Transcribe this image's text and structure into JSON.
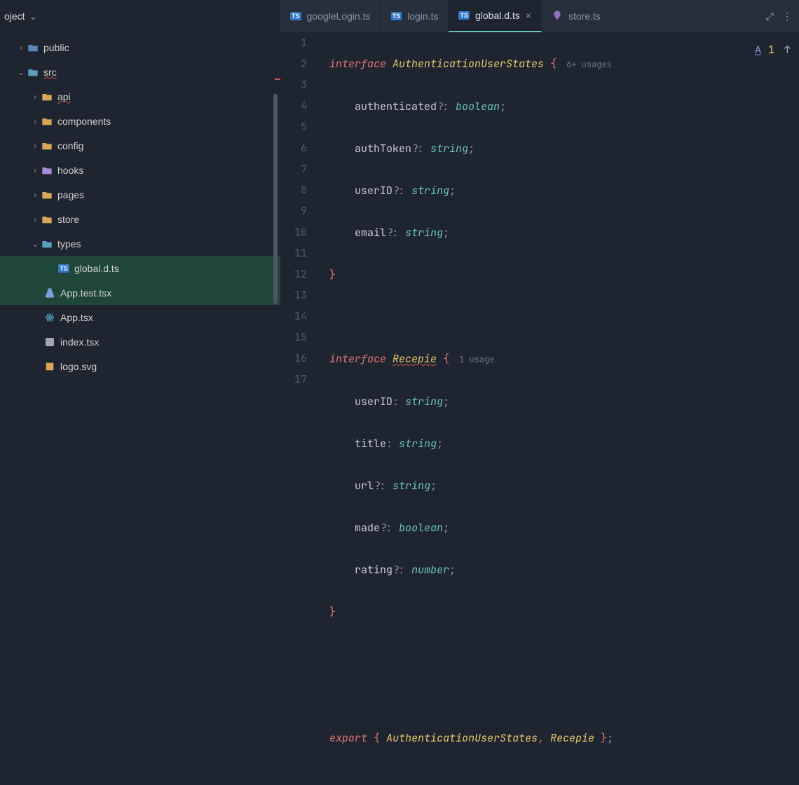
{
  "project": {
    "title": "oject"
  },
  "tree": {
    "public": "public",
    "src": "src",
    "api": "api",
    "components": "components",
    "config": "config",
    "hooks": "hooks",
    "pages": "pages",
    "store": "store",
    "types": "types",
    "globaldts": "global.d.ts",
    "apptest": "App.test.tsx",
    "apptsx": "App.tsx",
    "indextsx": "index.tsx",
    "logosvg": "logo.svg"
  },
  "tabs": {
    "0": "googleLogin.ts",
    "1": "login.ts",
    "2": "global.d.ts",
    "3": "store.ts"
  },
  "inspect": {
    "count": "1"
  },
  "code": {
    "l1_kw": "interface",
    "l1_name": "AuthenticationUserStates",
    "l1_brace": "{",
    "l1_usage": "6+ usages",
    "l2_p": "authenticated",
    "l2_t": "boolean",
    "l3_p": "authToken",
    "l3_t": "string",
    "l4_p": "userID",
    "l4_t": "string",
    "l5_p": "email",
    "l5_t": "string",
    "l6_brace": "}",
    "l8_kw": "interface",
    "l8_name": "Recepie",
    "l8_brace": "{",
    "l8_usage": "1 usage",
    "l9_p": "userID",
    "l9_t": "string",
    "l10_p": "title",
    "l10_t": "string",
    "l11_p": "url",
    "l11_t": "string",
    "l12_p": "made",
    "l12_t": "boolean",
    "l13_p": "rating",
    "l13_t": "number",
    "l14_brace": "}",
    "l17_kw": "export",
    "l17_brace_o": "{",
    "l17_n1": "AuthenticationUserStates",
    "l17_comma": ",",
    "l17_n2": "Recepie",
    "l17_brace_c": "}",
    "opt": "?:",
    "colon": ":",
    "semi": ";"
  },
  "lines": [
    "1",
    "2",
    "3",
    "4",
    "5",
    "6",
    "7",
    "8",
    "9",
    "10",
    "11",
    "12",
    "13",
    "14",
    "15",
    "16",
    "17"
  ]
}
